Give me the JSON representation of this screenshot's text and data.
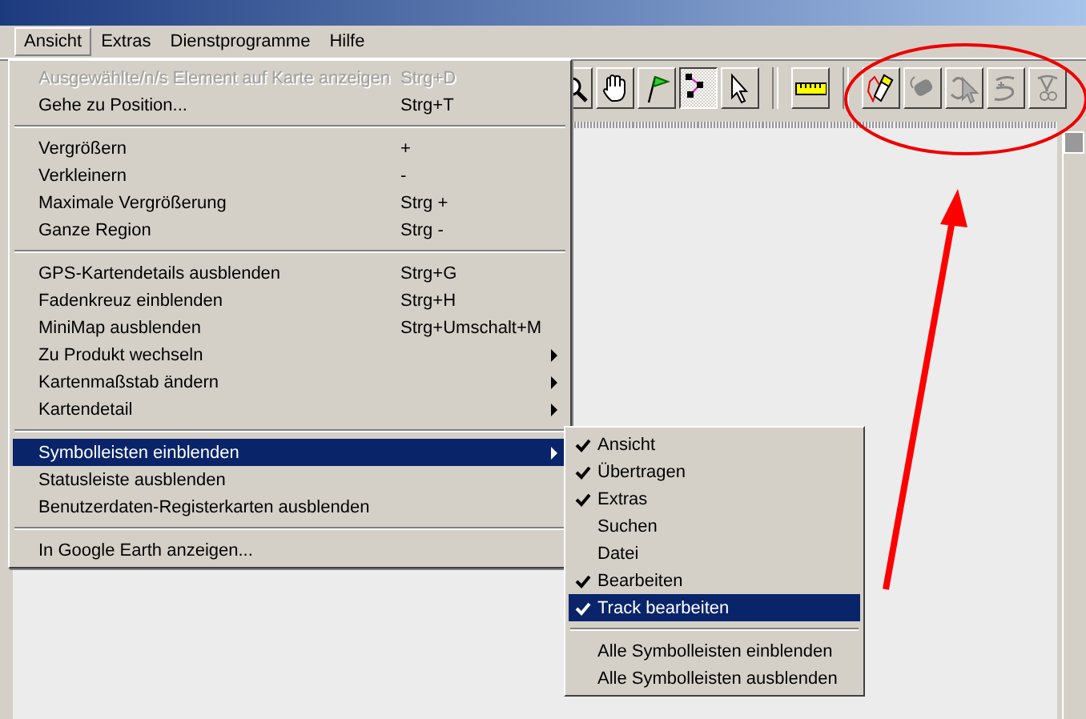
{
  "menubar": [
    {
      "label": "Ansicht",
      "selected": true
    },
    {
      "label": "Extras",
      "selected": false
    },
    {
      "label": "Dienstprogramme",
      "selected": false
    },
    {
      "label": "Hilfe",
      "selected": false
    }
  ],
  "toolbar": [
    {
      "kind": "zoom",
      "pressed": false,
      "disabled": false
    },
    {
      "kind": "hand",
      "pressed": false,
      "disabled": false
    },
    {
      "kind": "flag",
      "pressed": false,
      "disabled": false
    },
    {
      "kind": "nodes",
      "pressed": true,
      "disabled": false
    },
    {
      "kind": "pointer",
      "pressed": false,
      "disabled": false
    },
    {
      "kind": "separator"
    },
    {
      "kind": "ruler",
      "pressed": false,
      "disabled": false
    },
    {
      "kind": "separator"
    },
    {
      "kind": "pencil",
      "pressed": false,
      "disabled": false
    },
    {
      "kind": "eraser",
      "pressed": false,
      "disabled": true
    },
    {
      "kind": "select",
      "pressed": false,
      "disabled": true
    },
    {
      "kind": "track",
      "pressed": false,
      "disabled": true
    },
    {
      "kind": "cut",
      "pressed": false,
      "disabled": true
    }
  ],
  "menu": [
    {
      "kind": "item",
      "label": "Ausgewählte/n/s Element auf Karte anzeigen",
      "shortcut": "Strg+D",
      "disabled": true,
      "submenu": false,
      "selected": false
    },
    {
      "kind": "item",
      "label": "Gehe zu Position...",
      "shortcut": "Strg+T",
      "disabled": false,
      "submenu": false,
      "selected": false
    },
    {
      "kind": "separator"
    },
    {
      "kind": "item",
      "label": "Vergrößern",
      "shortcut": "+",
      "disabled": false,
      "submenu": false,
      "selected": false
    },
    {
      "kind": "item",
      "label": "Verkleinern",
      "shortcut": "-",
      "disabled": false,
      "submenu": false,
      "selected": false
    },
    {
      "kind": "item",
      "label": "Maximale Vergrößerung",
      "shortcut": "Strg +",
      "disabled": false,
      "submenu": false,
      "selected": false
    },
    {
      "kind": "item",
      "label": "Ganze Region",
      "shortcut": "Strg -",
      "disabled": false,
      "submenu": false,
      "selected": false
    },
    {
      "kind": "separator"
    },
    {
      "kind": "item",
      "label": "GPS-Kartendetails ausblenden",
      "shortcut": "Strg+G",
      "disabled": false,
      "submenu": false,
      "selected": false
    },
    {
      "kind": "item",
      "label": "Fadenkreuz einblenden",
      "shortcut": "Strg+H",
      "disabled": false,
      "submenu": false,
      "selected": false
    },
    {
      "kind": "item",
      "label": "MiniMap ausblenden",
      "shortcut": "Strg+Umschalt+M",
      "disabled": false,
      "submenu": false,
      "selected": false
    },
    {
      "kind": "item",
      "label": "Zu Produkt wechseln",
      "disabled": false,
      "submenu": true,
      "selected": false
    },
    {
      "kind": "item",
      "label": "Kartenmaßstab ändern",
      "disabled": false,
      "submenu": true,
      "selected": false
    },
    {
      "kind": "item",
      "label": "Kartendetail",
      "disabled": false,
      "submenu": true,
      "selected": false
    },
    {
      "kind": "separator"
    },
    {
      "kind": "item",
      "label": "Symbolleisten einblenden",
      "disabled": false,
      "submenu": true,
      "selected": true
    },
    {
      "kind": "item",
      "label": "Statusleiste ausblenden",
      "disabled": false,
      "submenu": false,
      "selected": false
    },
    {
      "kind": "item",
      "label": "Benutzerdaten-Registerkarten ausblenden",
      "disabled": false,
      "submenu": false,
      "selected": false
    },
    {
      "kind": "separator"
    },
    {
      "kind": "item",
      "label": "In Google Earth anzeigen...",
      "disabled": false,
      "submenu": false,
      "selected": false
    }
  ],
  "submenu": [
    {
      "kind": "item",
      "label": "Ansicht",
      "checked": true,
      "selected": false
    },
    {
      "kind": "item",
      "label": "Übertragen",
      "checked": true,
      "selected": false
    },
    {
      "kind": "item",
      "label": "Extras",
      "checked": true,
      "selected": false
    },
    {
      "kind": "item",
      "label": "Suchen",
      "checked": false,
      "selected": false
    },
    {
      "kind": "item",
      "label": "Datei",
      "checked": false,
      "selected": false
    },
    {
      "kind": "item",
      "label": "Bearbeiten",
      "checked": true,
      "selected": false
    },
    {
      "kind": "item",
      "label": "Track bearbeiten",
      "checked": true,
      "selected": true
    },
    {
      "kind": "separator"
    },
    {
      "kind": "item",
      "label": "Alle Symbolleisten einblenden",
      "checked": false,
      "selected": false
    },
    {
      "kind": "item",
      "label": "Alle Symbolleisten ausblenden",
      "checked": false,
      "selected": false
    }
  ]
}
